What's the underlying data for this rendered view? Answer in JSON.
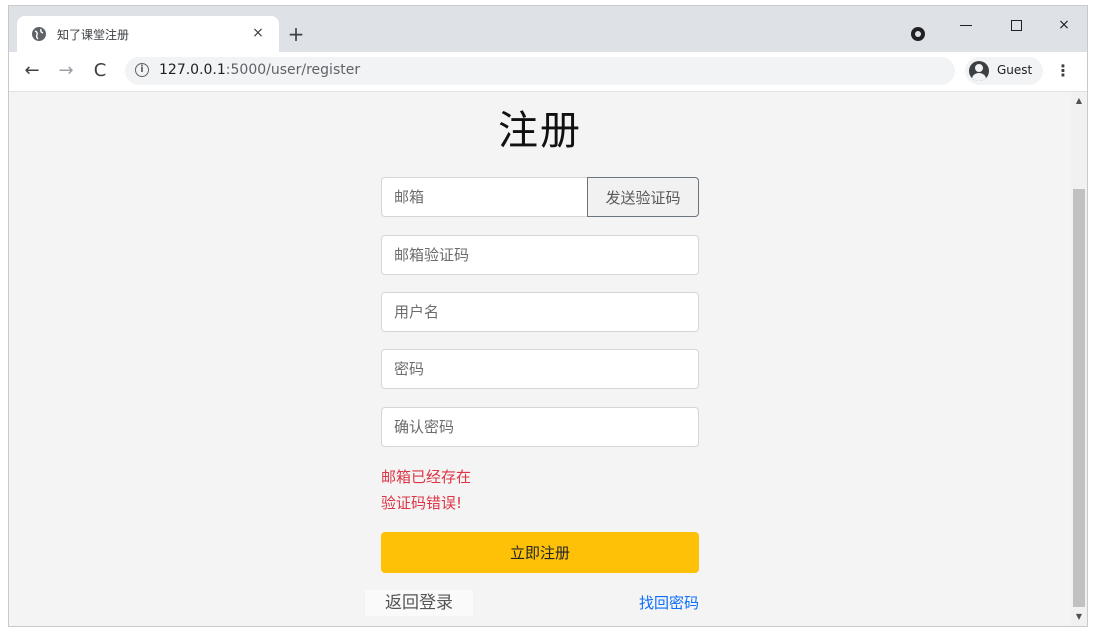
{
  "browser": {
    "tab_title": "知了课堂注册",
    "tab_close": "×",
    "new_tab": "+",
    "url_host": "127.0.0.1",
    "url_path": ":5000/user/register",
    "profile_label": "Guest",
    "menu": "⋮",
    "nav_back": "←",
    "nav_forward": "→",
    "nav_reload": "C",
    "omni_info": "i",
    "win_close": "×"
  },
  "form": {
    "title": "注册",
    "email_placeholder": "邮箱",
    "send_code_label": "发送验证码",
    "email_code_placeholder": "邮箱验证码",
    "username_placeholder": "用户名",
    "password_placeholder": "密码",
    "confirm_password_placeholder": "确认密码",
    "errors": [
      "邮箱已经存在",
      "验证码错误!"
    ],
    "register_label": "立即注册",
    "back_login_label": "返回登录",
    "find_password_label": "找回密码"
  },
  "colors": {
    "accent_button": "#ffc107",
    "error_text": "#dc3545",
    "link_text": "#0d6efd"
  }
}
